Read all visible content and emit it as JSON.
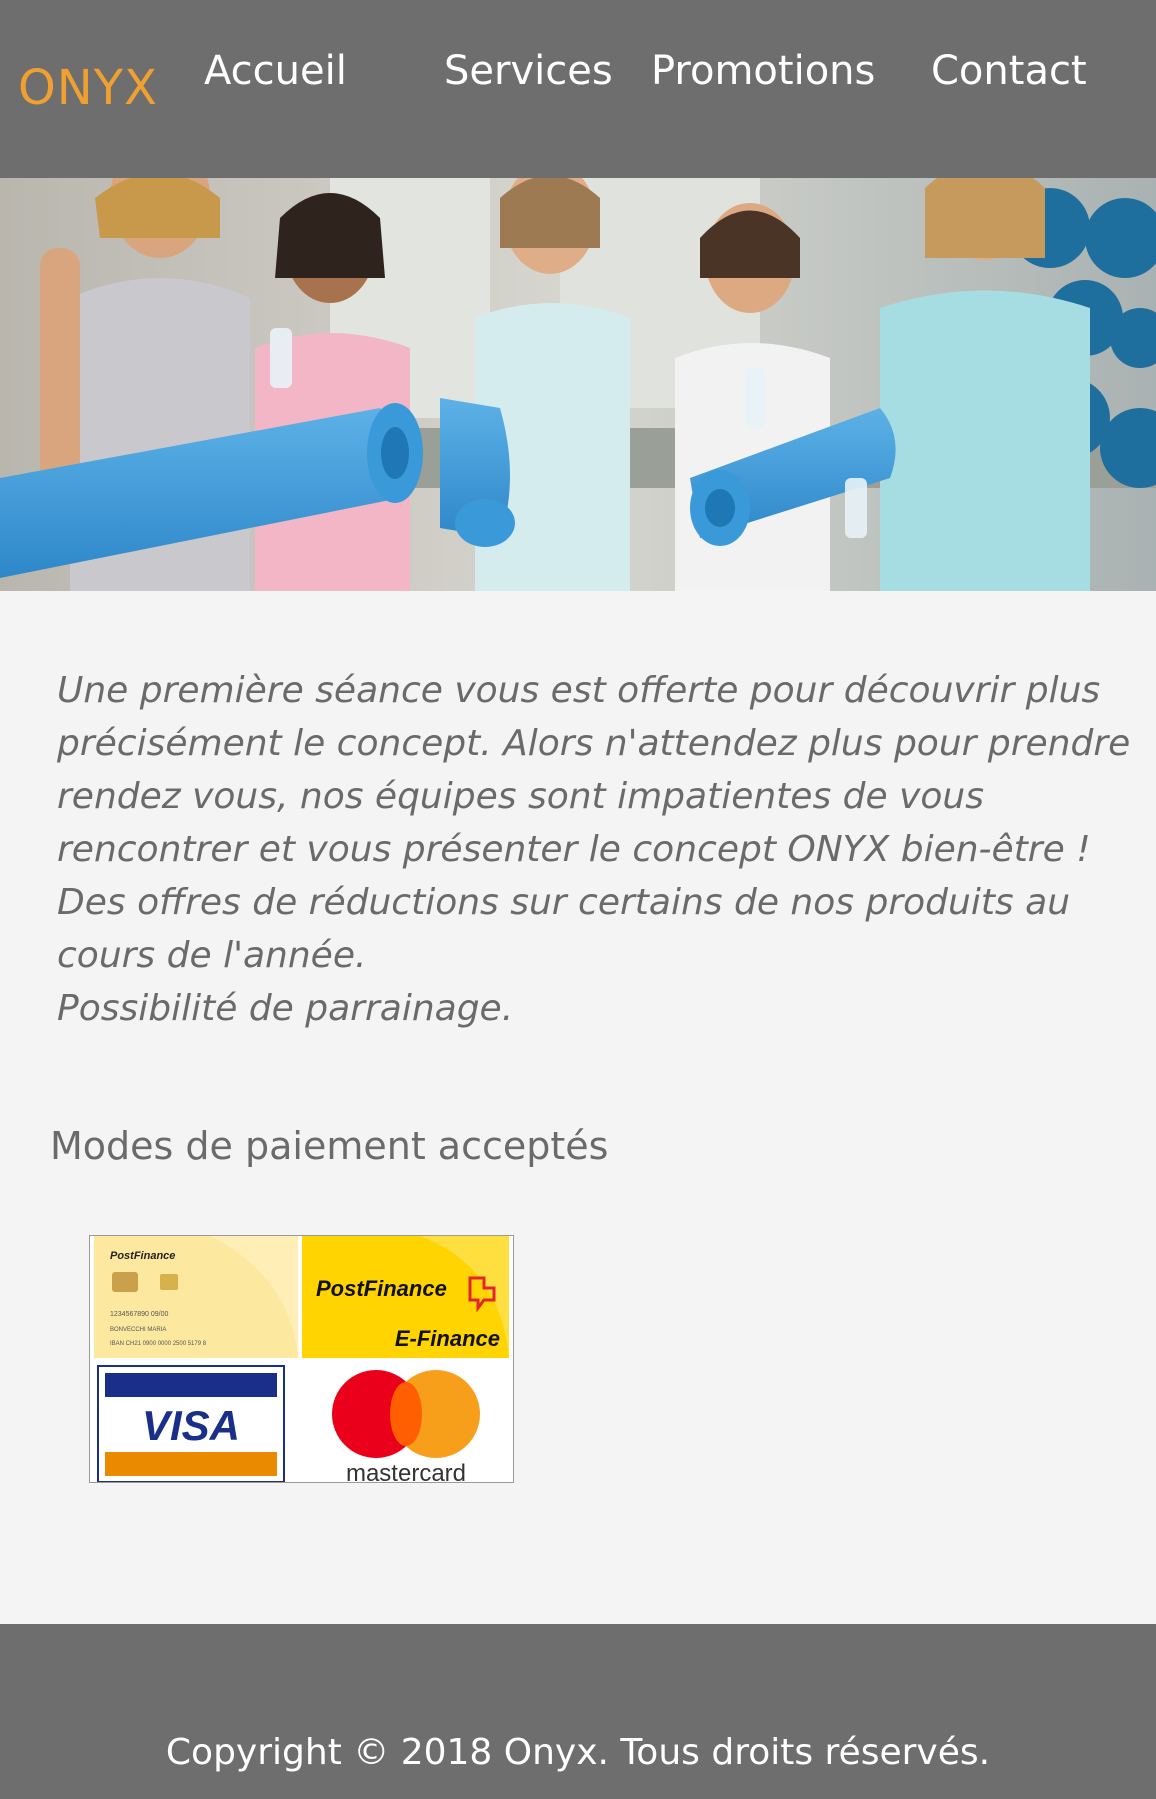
{
  "header": {
    "logo": "ONYX",
    "nav": [
      "Accueil",
      "Services",
      "Promotions",
      "Contact"
    ]
  },
  "intro": {
    "lines": [
      "Une première séance vous est offerte pour découvrir plus",
      "précisément le concept. Alors n'attendez plus pour prendre",
      "rendez vous, nos équipes sont impatientes de vous",
      "rencontrer et vous présenter le concept ONYX bien-être !",
      "Des offres de réductions sur certains de nos produits au",
      "cours de l'année.",
      "Possibilité de parrainage."
    ]
  },
  "payment": {
    "title": "Modes de paiement acceptés",
    "cards": {
      "pf_card_brand": "PostFinance",
      "pf_card_number": "1234567890   09/00",
      "pf_card_name": "BONVECCHI MARIA",
      "pf_card_iban": "IBAN CH21 0900 0000 2500 5179 8",
      "efinance_brand": "PostFinance",
      "efinance_label": "E-Finance",
      "visa_label": "VISA",
      "mastercard_label": "mastercard"
    }
  },
  "footer": {
    "copyright": "Copyright © 2018 Onyx. Tous droits réservés."
  },
  "colors": {
    "header_bg": "#6e6e6e",
    "logo": "#f0a030",
    "body_bg": "#f4f4f4",
    "text": "#6a6a6a"
  }
}
